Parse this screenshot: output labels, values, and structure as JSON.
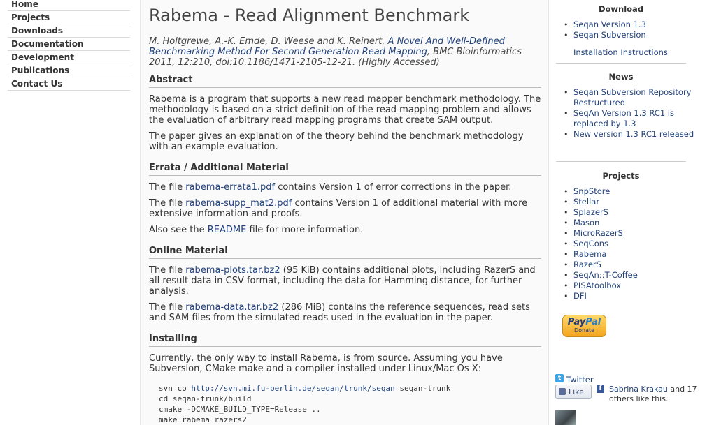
{
  "nav": [
    "Home",
    "Projects",
    "Downloads",
    "Documentation",
    "Development",
    "Publications",
    "Contact Us"
  ],
  "title": "Rabema - Read Alignment Benchmark",
  "citation": {
    "authors": "M. Holtgrewe, A.-K. Emde, D. Weese and K. Reinert.",
    "paper_link": "A Novel And Well-Defined Benchmarking Method For Second Generation Read Mapping",
    "suffix": ", BMC Bioinformatics 2011, 12:210, doi:10.1186/1471-2105-12-21. (Highly Accessed)"
  },
  "abstract": {
    "heading": "Abstract",
    "p1": "Rabema is a program that supports a new read mapper benchmark methodology. The methodology is based on a strict definition of the read mapping problem and allows the evaluation of arbitrary read mapping programs that create SAM output.",
    "p2": "The paper gives an explanation of the theory behind the benchmark methodology with an example evaluation."
  },
  "errata": {
    "heading": "Errata / Additional Material",
    "p1_pre": "The file ",
    "p1_link": "rabema-errata1.pdf",
    "p1_post": " contains Version 1 of error corrections in the paper.",
    "p2_pre": "The file ",
    "p2_link": "rabema-supp_mat2.pdf",
    "p2_post": " contains Version 1 of additional material with more extensive information and proofs.",
    "p3_pre": "Also see the ",
    "p3_link": "README",
    "p3_post": " file for more information."
  },
  "online": {
    "heading": "Online Material",
    "p1_pre": "The file ",
    "p1_link": "rabema-plots.tar.bz2",
    "p1_post": " (95 KiB) contains additional plots, including RazerS and all result data in CSV format, including the data for Hamming distance, for further analysis.",
    "p2_pre": "The file ",
    "p2_link": "rabema-data.tar.bz2",
    "p2_post": " (286 MiB) contains the reference sequences, read sets and SAM files from the simulated reads used in the evaluation in the paper."
  },
  "installing": {
    "heading": "Installing",
    "p1": "Currently, the only way to install Rabema, is from source. Assuming you have Subversion, CMake make and a compiler installed under Linux/Mac Os X:",
    "code1_pre": "svn co ",
    "code1_link": "http://svn.mi.fu-berlin.de/seqan/trunk/seqan",
    "code1_post": " seqan-trunk",
    "code2": "cd seqan-trunk/build",
    "code3": "cmake -DCMAKE_BUILD_TYPE=Release ..",
    "code4": "make rabema razers2"
  },
  "sidebar": {
    "download": {
      "heading": "Download",
      "items": [
        "Seqan Version 1.3",
        "Seqan Subversion"
      ],
      "install_link": "Installation Instructions"
    },
    "news": {
      "heading": "News",
      "items": [
        "Seqan Subversion Repository Restructured",
        "SeqAn Version 1.3 RC1 is replaced by 1.3",
        "New version 1.3 RC1 released"
      ]
    },
    "projects": {
      "heading": "Projects",
      "items": [
        "SnpStore",
        "Stellar",
        "SplazerS",
        "Mason",
        "MicroRazerS",
        "SeqCons",
        "Rabema",
        "RazerS",
        "SeqAn::T-Coffee",
        "PISAtoolbox",
        "DFI"
      ]
    },
    "paypal": {
      "brand_a": "Pay",
      "brand_b": "Pal",
      "label": "Donate"
    },
    "twitter": "Twitter",
    "like": "Like",
    "fb_name": "Sabrina Krakau",
    "fb_rest": " and 17 others like this."
  }
}
